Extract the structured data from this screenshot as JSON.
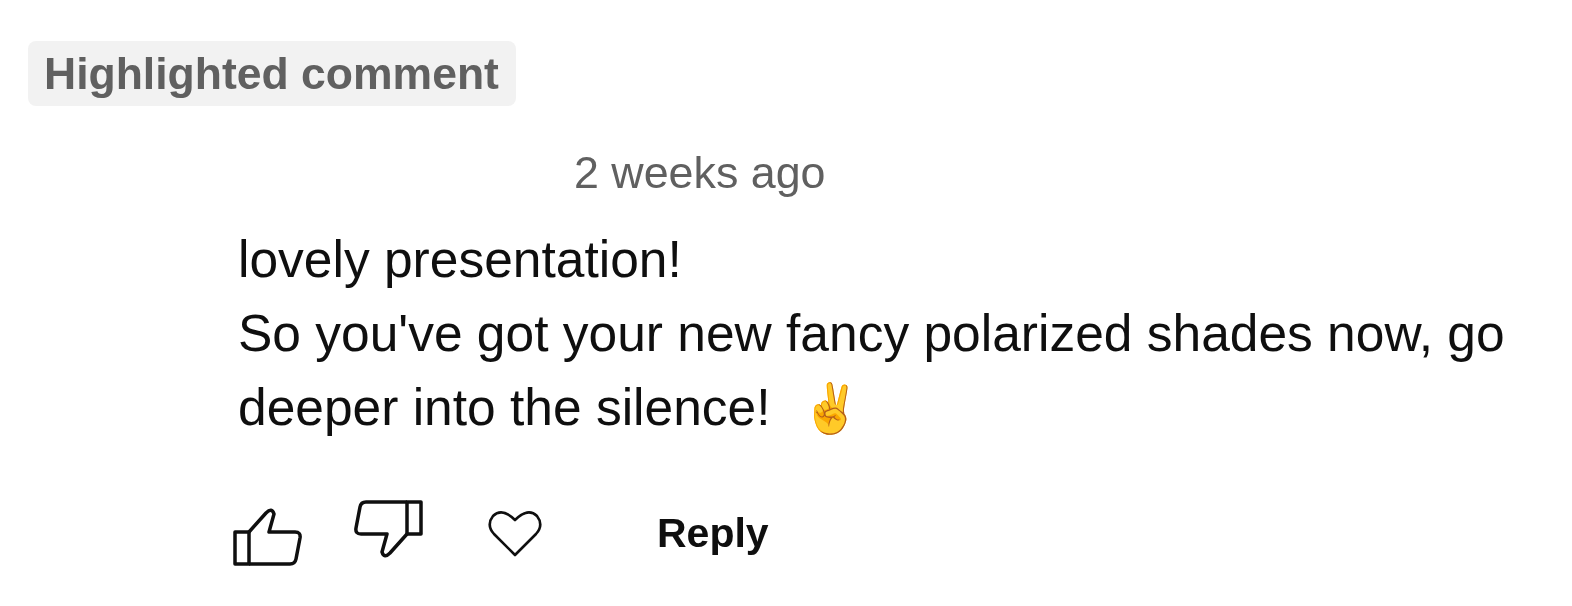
{
  "badge": {
    "label": "Highlighted comment"
  },
  "comment": {
    "timestamp": "2 weeks ago",
    "text": "lovely presentation!\nSo you've got your new fancy polarized shades now, go deeper into the silence!",
    "emoji": "✌️"
  },
  "actions": {
    "reply": "Reply"
  }
}
